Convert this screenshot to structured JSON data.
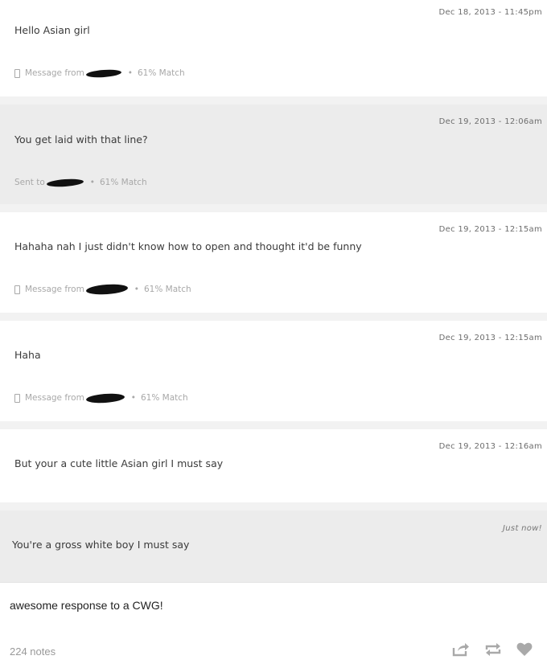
{
  "messages": [
    {
      "timestamp": "Dec 18, 2013 - 11:45pm",
      "text": "Hello Asian girl",
      "meta_prefix": "Message from",
      "match": "61% Match"
    },
    {
      "timestamp": "Dec 19, 2013 - 12:06am",
      "text": "You get laid with that line?",
      "meta_prefix": "Sent to",
      "match": "61% Match"
    },
    {
      "timestamp": "Dec 19, 2013 - 12:15am",
      "text": "Hahaha nah I just didn't know how to open and thought it'd be funny",
      "meta_prefix": "Message from",
      "match": "61% Match"
    },
    {
      "timestamp": "Dec 19, 2013 - 12:15am",
      "text": "Haha",
      "meta_prefix": "Message from",
      "match": "61% Match"
    },
    {
      "timestamp": "Dec 19, 2013 - 12:16am",
      "text": "But your a cute little Asian girl I must say"
    },
    {
      "timestamp": "Just now!",
      "text": "You're a gross white boy I must say"
    }
  ],
  "post": {
    "caption": "awesome response to a CWG!",
    "notes": "224 notes"
  },
  "icons": {
    "share": "share-icon",
    "reblog": "reblog-icon",
    "like": "heart-icon"
  },
  "colors": {
    "sent_bg": "#ececec",
    "recv_bg": "#ffffff",
    "meta_text": "#a8a8a8"
  }
}
